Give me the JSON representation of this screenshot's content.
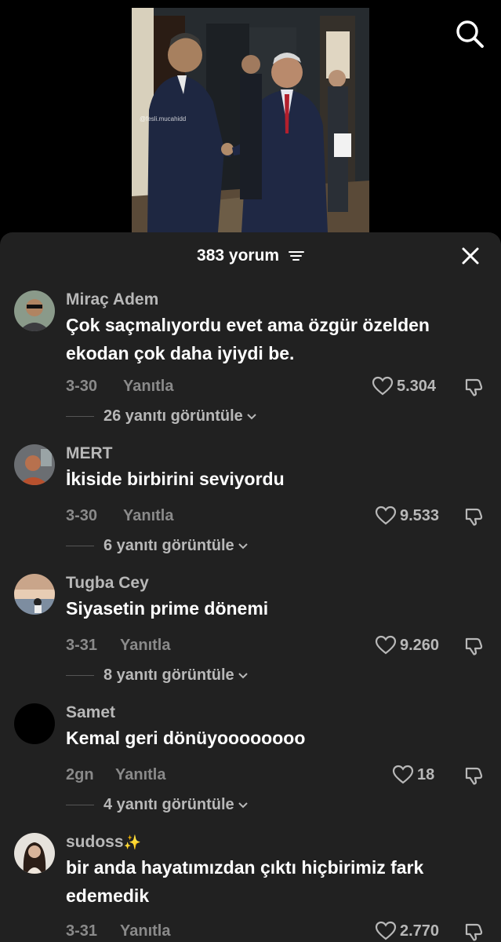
{
  "video": {
    "watermark": "@fesli.mucahidd"
  },
  "comments_header": {
    "count_label": "383 yorum"
  },
  "comments": [
    {
      "username": "Miraç Adem",
      "text": "Çok saçmalıyordu evet ama özgür özelden ekodan çok daha iyiydi be.",
      "date": "3-30",
      "reply_label": "Yanıtla",
      "likes": "5.304",
      "view_replies": "26 yanıtı görüntüle"
    },
    {
      "username": "MERT",
      "text": "İkiside birbirini seviyordu",
      "date": "3-30",
      "reply_label": "Yanıtla",
      "likes": "9.533",
      "view_replies": "6 yanıtı görüntüle"
    },
    {
      "username": "Tugba Cey",
      "text": "Siyasetin prime dönemi",
      "date": "3-31",
      "reply_label": "Yanıtla",
      "likes": "9.260",
      "view_replies": "8 yanıtı görüntüle"
    },
    {
      "username": "Samet",
      "text": "Kemal geri dönüyoooooooo",
      "date": "2gn",
      "reply_label": "Yanıtla",
      "likes": "18",
      "view_replies": "4 yanıtı görüntüle"
    },
    {
      "username": "sudoss",
      "username_emoji": "✨",
      "text": "bir anda hayatımızdan çıktı hiçbirimiz fark edemedik",
      "date": "3-31",
      "reply_label": "Yanıtla",
      "likes": "2.770"
    }
  ],
  "colors": {
    "sheet_background": "#212121",
    "primary_text": "#ffffff",
    "secondary_text": "#b8b8b8",
    "meta_text": "#8a8a8a"
  },
  "icons": [
    "search-icon",
    "filter-icon",
    "close-icon",
    "heart-icon",
    "dislike-icon",
    "chevron-down-icon"
  ]
}
